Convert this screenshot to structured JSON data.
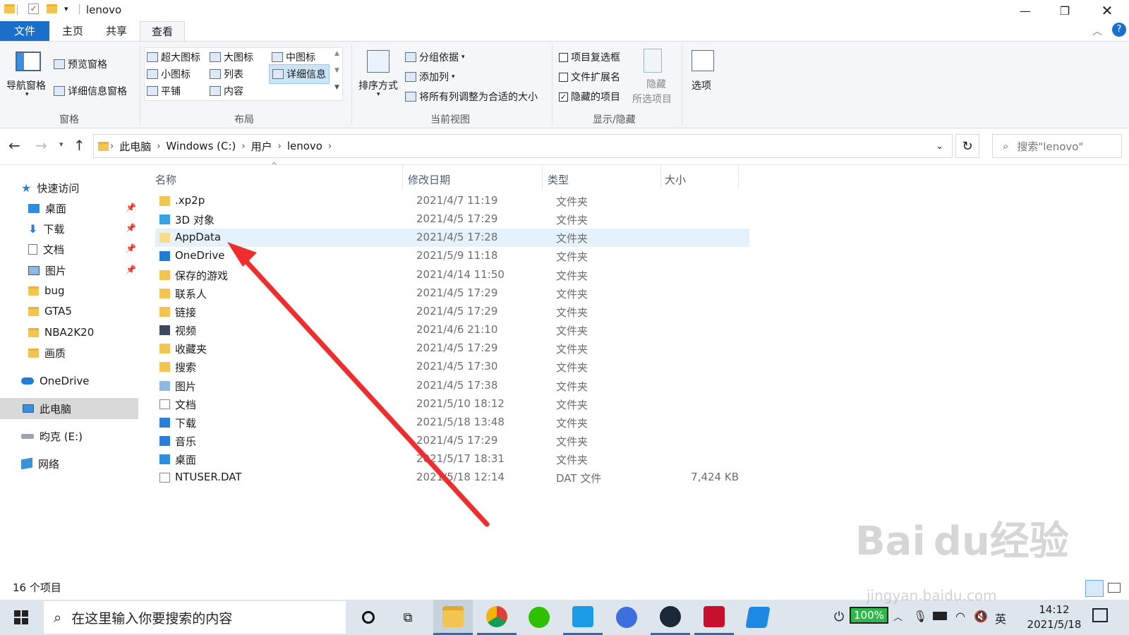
{
  "window": {
    "title": "lenovo",
    "controls": [
      "minimize",
      "restore",
      "close"
    ]
  },
  "ribbon_tabs": [
    {
      "label": "文件",
      "active": false,
      "kind": "file"
    },
    {
      "label": "主页",
      "active": false
    },
    {
      "label": "共享",
      "active": false
    },
    {
      "label": "查看",
      "active": true
    }
  ],
  "ribbon": {
    "panes": {
      "nav_pane": "导航窗格",
      "preview_pane": "预览窗格",
      "details_pane": "详细信息窗格",
      "group_label": "窗格"
    },
    "layout": {
      "items": [
        "超大图标",
        "大图标",
        "中图标",
        "小图标",
        "列表",
        "详细信息",
        "平铺",
        "内容"
      ],
      "selected": "详细信息",
      "group_label": "布局"
    },
    "current_view": {
      "sort_by": "排序方式",
      "group_by": "分组依据",
      "add_column": "添加列",
      "fit_columns": "将所有列调整为合适的大小",
      "group_label": "当前视图"
    },
    "show_hide": {
      "item_checkboxes": {
        "label": "项目复选框",
        "checked": false
      },
      "file_extensions": {
        "label": "文件扩展名",
        "checked": false
      },
      "hidden_items": {
        "label": "隐藏的项目",
        "checked": true
      },
      "hide_selected_l1": "隐藏",
      "hide_selected_l2": "所选项目",
      "group_label": "显示/隐藏"
    },
    "options": "选项"
  },
  "address": {
    "breadcrumb": [
      "此电脑",
      "Windows (C:)",
      "用户",
      "lenovo"
    ],
    "search_placeholder": "搜索\"lenovo\""
  },
  "nav_pane": {
    "quick_access": "快速访问",
    "quick_items": [
      {
        "label": "桌面",
        "pinned": true
      },
      {
        "label": "下载",
        "pinned": true
      },
      {
        "label": "文档",
        "pinned": true
      },
      {
        "label": "图片",
        "pinned": true
      },
      {
        "label": "bug",
        "pinned": false
      },
      {
        "label": "GTA5",
        "pinned": false
      },
      {
        "label": "NBA2K20",
        "pinned": false
      },
      {
        "label": "画质",
        "pinned": false
      }
    ],
    "onedrive": "OneDrive",
    "this_pc": "此电脑",
    "drive_e": "昀克 (E:)",
    "network": "网络"
  },
  "columns": {
    "name": "名称",
    "date": "修改日期",
    "type": "类型",
    "size": "大小"
  },
  "files": [
    {
      "name": ".xp2p",
      "date": "2021/4/7 11:19",
      "type": "文件夹",
      "size": ""
    },
    {
      "name": "3D 对象",
      "date": "2021/4/5 17:29",
      "type": "文件夹",
      "size": ""
    },
    {
      "name": "AppData",
      "date": "2021/4/5 17:28",
      "type": "文件夹",
      "size": "",
      "selected": true
    },
    {
      "name": "OneDrive",
      "date": "2021/5/9 11:18",
      "type": "文件夹",
      "size": ""
    },
    {
      "name": "保存的游戏",
      "date": "2021/4/14 11:50",
      "type": "文件夹",
      "size": ""
    },
    {
      "name": "联系人",
      "date": "2021/4/5 17:29",
      "type": "文件夹",
      "size": ""
    },
    {
      "name": "链接",
      "date": "2021/4/5 17:29",
      "type": "文件夹",
      "size": ""
    },
    {
      "name": "视频",
      "date": "2021/4/6 21:10",
      "type": "文件夹",
      "size": ""
    },
    {
      "name": "收藏夹",
      "date": "2021/4/5 17:29",
      "type": "文件夹",
      "size": ""
    },
    {
      "name": "搜索",
      "date": "2021/4/5 17:30",
      "type": "文件夹",
      "size": ""
    },
    {
      "name": "图片",
      "date": "2021/4/5 17:38",
      "type": "文件夹",
      "size": ""
    },
    {
      "name": "文档",
      "date": "2021/5/10 18:12",
      "type": "文件夹",
      "size": ""
    },
    {
      "name": "下载",
      "date": "2021/5/18 13:48",
      "type": "文件夹",
      "size": ""
    },
    {
      "name": "音乐",
      "date": "2021/4/5 17:29",
      "type": "文件夹",
      "size": ""
    },
    {
      "name": "桌面",
      "date": "2021/5/17 18:31",
      "type": "文件夹",
      "size": ""
    },
    {
      "name": "NTUSER.DAT",
      "date": "2021/5/18 12:14",
      "type": "DAT 文件",
      "size": "7,424 KB"
    }
  ],
  "status": {
    "item_count": "16 个项目"
  },
  "taskbar": {
    "search_placeholder": "在这里输入你要搜索的内容",
    "battery": "100%",
    "ime": "英",
    "time": "14:12",
    "date": "2021/5/18"
  },
  "watermark": {
    "logo": "Baidu经验",
    "url": "jingyan.baidu.com"
  },
  "colors": {
    "accent": "#1a6fc8",
    "selection": "#e5f1fb",
    "taskbar": "#dde6ec",
    "annotation_arrow": "#ef2d2d"
  }
}
